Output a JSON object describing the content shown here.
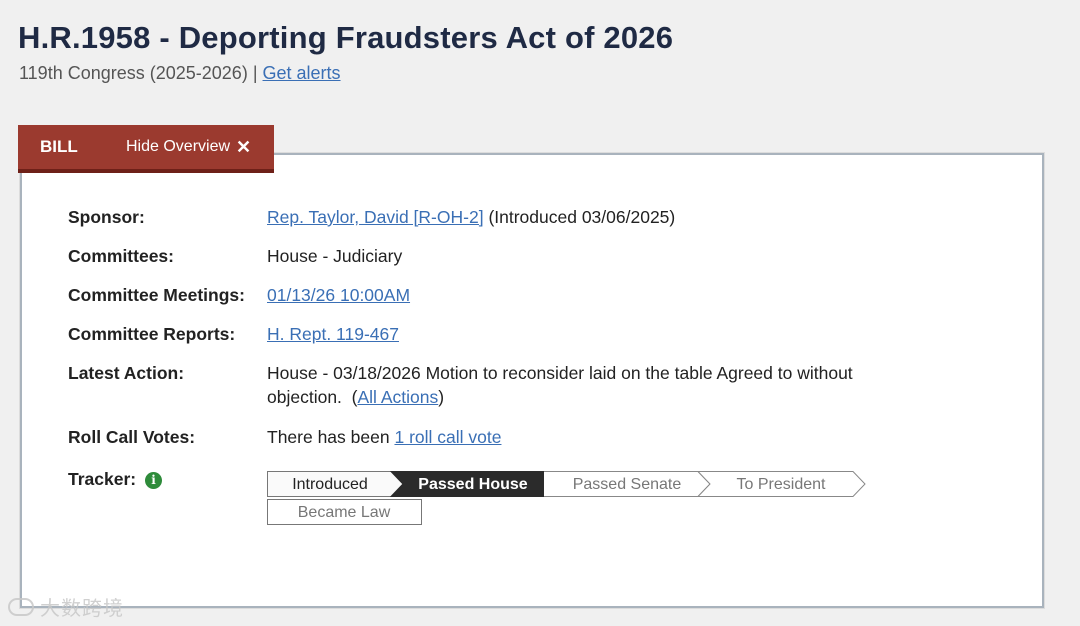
{
  "header": {
    "title": "H.R.1958 - Deporting Fraudsters Act of 2026",
    "congress": "119th Congress (2025-2026) |",
    "alerts_link": "Get alerts"
  },
  "tabs": {
    "bill": "BILL",
    "hide_overview": "Hide Overview"
  },
  "overview": {
    "sponsor_label": "Sponsor:",
    "sponsor_link": "Rep. Taylor, David [R-OH-2]",
    "sponsor_note": "(Introduced 03/06/2025)",
    "committees_label": "Committees:",
    "committees_value": "House - Judiciary",
    "meetings_label": "Committee Meetings:",
    "meetings_link": "01/13/26 10:00AM",
    "reports_label": "Committee Reports:",
    "reports_link": "H. Rept. 119-467",
    "latest_label": "Latest Action:",
    "latest_text": "House - 03/18/2026 Motion to reconsider laid on the table Agreed to without objection.",
    "latest_open": "(",
    "latest_link": "All Actions",
    "latest_close": ")",
    "rollcall_label": "Roll Call Votes:",
    "rollcall_text": "There has been",
    "rollcall_link": "1 roll call vote",
    "tracker_label": "Tracker:"
  },
  "tracker": {
    "steps": [
      "Introduced",
      "Passed House",
      "Passed Senate",
      "To President",
      "Became Law"
    ],
    "current_step": "Passed House"
  },
  "watermark": "大数跨境",
  "colors": {
    "tab_bg": "#9b3a2f",
    "link": "#3a6fb5",
    "tracker_active": "#2b2b2b",
    "info_icon": "#2e8b3a"
  }
}
